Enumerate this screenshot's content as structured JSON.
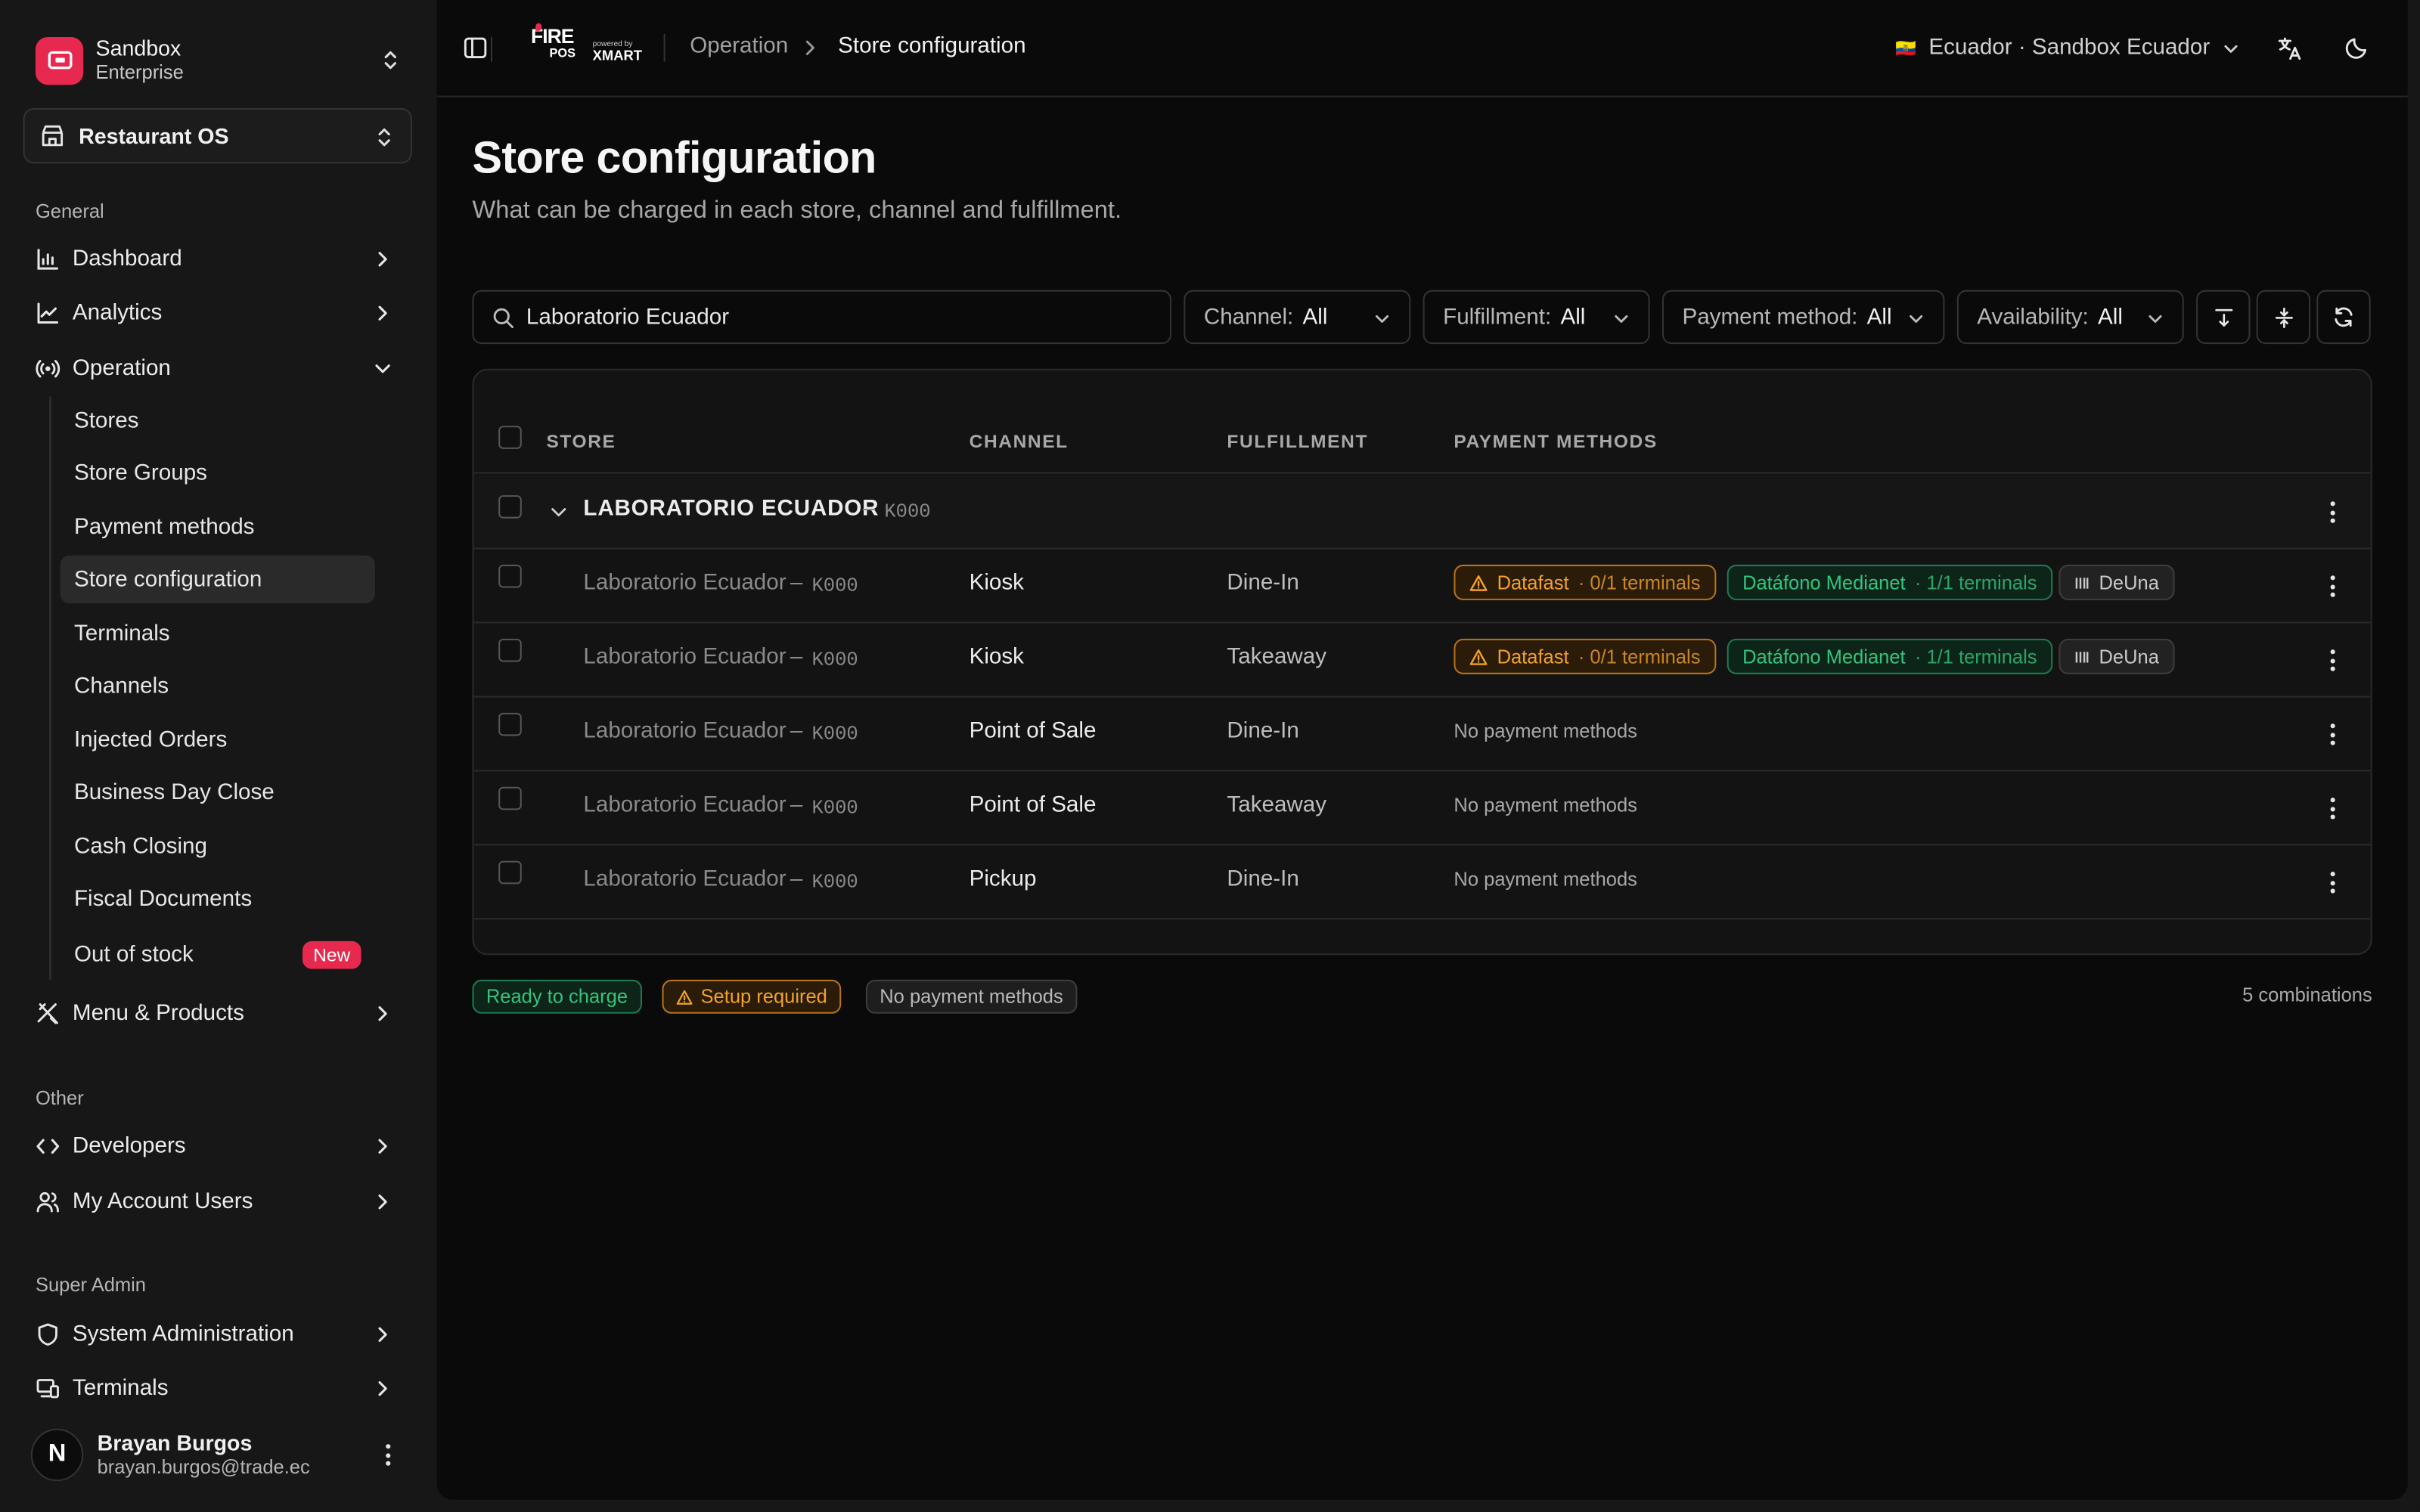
{
  "org": {
    "name": "Sandbox",
    "plan": "Enterprise"
  },
  "app_selector": {
    "label": "Restaurant OS"
  },
  "sections": {
    "general": "General",
    "other": "Other",
    "super_admin": "Super Admin"
  },
  "nav": {
    "dashboard": "Dashboard",
    "analytics": "Analytics",
    "operation": "Operation",
    "menu_products": "Menu & Products",
    "developers": "Developers",
    "my_account_users": "My Account Users",
    "system_admin": "System Administration",
    "terminals": "Terminals"
  },
  "operation_items": [
    "Stores",
    "Store Groups",
    "Payment methods",
    "Store configuration",
    "Terminals",
    "Channels",
    "Injected Orders",
    "Business Day Close",
    "Cash Closing",
    "Fiscal Documents",
    "Out of stock"
  ],
  "new_badge": "New",
  "user": {
    "initial": "N",
    "name": "Brayan Burgos",
    "email": "brayan.burgos@trade.ec"
  },
  "topbar": {
    "logo_main": "FIRE",
    "logo_sub": "POS",
    "powered": "powered by",
    "partner": "XMART",
    "breadcrumb": [
      "Operation",
      "Store configuration"
    ],
    "country_flag": "🇪🇨",
    "country_selector": "Ecuador · Sandbox Ecuador"
  },
  "page": {
    "title": "Store configuration",
    "subtitle": "What can be charged in each store, channel and fulfillment."
  },
  "search": {
    "value": "Laboratorio Ecuador"
  },
  "filters": [
    {
      "key": "Channel:",
      "value": "All"
    },
    {
      "key": "Fulfillment:",
      "value": "All"
    },
    {
      "key": "Payment method:",
      "value": "All"
    },
    {
      "key": "Availability:",
      "value": "All"
    }
  ],
  "table": {
    "headers": [
      "STORE",
      "CHANNEL",
      "FULFILLMENT",
      "PAYMENT METHODS"
    ],
    "group": {
      "name": "LABORATORIO ECUADOR",
      "sep": "–",
      "code": "K000"
    },
    "rows": [
      {
        "store": "Laboratorio Ecuador",
        "sep": "–",
        "code": "K000",
        "channel": "Kiosk",
        "fulfillment": "Dine-In",
        "pms": [
          {
            "kind": "warn",
            "name": "Datafast",
            "detail": "· 0/1 terminals"
          },
          {
            "kind": "ok",
            "name": "Datáfono Medianet",
            "detail": "· 1/1 terminals"
          },
          {
            "kind": "neutral",
            "name": "DeUna",
            "detail": ""
          }
        ]
      },
      {
        "store": "Laboratorio Ecuador",
        "sep": "–",
        "code": "K000",
        "channel": "Kiosk",
        "fulfillment": "Takeaway",
        "pms": [
          {
            "kind": "warn",
            "name": "Datafast",
            "detail": "· 0/1 terminals"
          },
          {
            "kind": "ok",
            "name": "Datáfono Medianet",
            "detail": "· 1/1 terminals"
          },
          {
            "kind": "neutral",
            "name": "DeUna",
            "detail": ""
          }
        ]
      },
      {
        "store": "Laboratorio Ecuador",
        "sep": "–",
        "code": "K000",
        "channel": "Point of Sale",
        "fulfillment": "Dine-In",
        "no_pm": "No payment methods"
      },
      {
        "store": "Laboratorio Ecuador",
        "sep": "–",
        "code": "K000",
        "channel": "Point of Sale",
        "fulfillment": "Takeaway",
        "no_pm": "No payment methods"
      },
      {
        "store": "Laboratorio Ecuador",
        "sep": "–",
        "code": "K000",
        "channel": "Pickup",
        "fulfillment": "Dine-In",
        "no_pm": "No payment methods"
      }
    ]
  },
  "legend": {
    "ready": "Ready to charge",
    "setup": "Setup required",
    "none": "No payment methods"
  },
  "combinations": "5 combinations",
  "colors": {
    "brand": "#e8294f",
    "warn": "#f2a12a",
    "ok": "#34c47c"
  }
}
